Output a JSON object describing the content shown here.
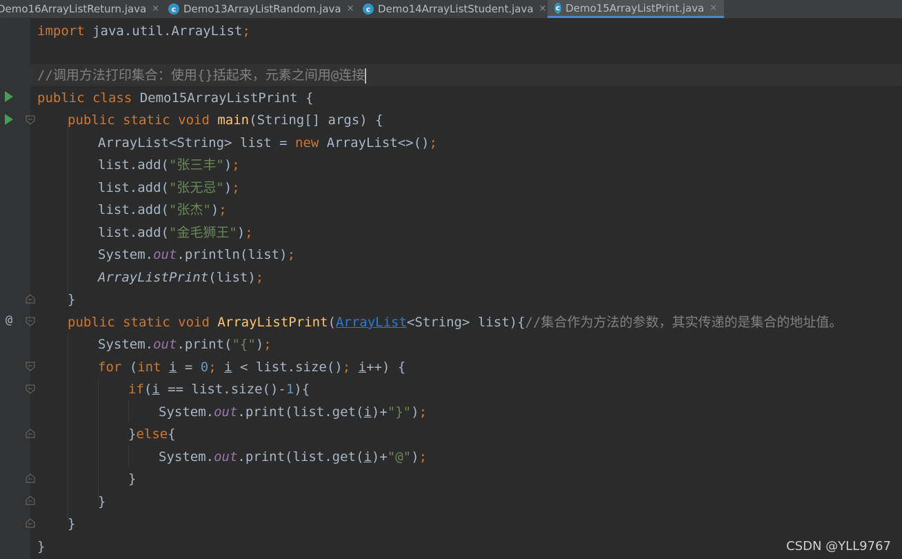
{
  "tabs": [
    {
      "label": "Demo16ArrayListReturn.java",
      "active": false
    },
    {
      "label": "Demo13ArrayListRandom.java",
      "active": false
    },
    {
      "label": "Demo14ArrayListStudent.java",
      "active": false
    },
    {
      "label": "Demo15ArrayListPrint.java",
      "active": true
    }
  ],
  "tab_close_glyph": "×",
  "file_icon_letter": "c",
  "gutter_at_glyph": "@",
  "code": {
    "import_kw": "import",
    "import_path": " java.util.ArrayList",
    "semicolon": ";",
    "comment_top": "//调用方法打印集合：使用{}括起来，元素之间用@连接",
    "class_decl": "public class",
    "class_name": " Demo15ArrayListPrint {",
    "main_mods": "public static void",
    "main_name": "main",
    "main_params": "(String[] args) {",
    "list_decl_type": "ArrayList<String> list = ",
    "new_kw": "new",
    "list_decl_rest": " ArrayList<>()",
    "add_prefix": "list.add(",
    "add_values": [
      "\"张三丰\"",
      "\"张无忌\"",
      "\"张杰\"",
      "\"金毛狮王\""
    ],
    "add_suffix": ")",
    "system": "System.",
    "out": "out",
    "println_call": ".println(list)",
    "call_name": "ArrayListPrint",
    "call_args": "(list)",
    "close_brace": "}",
    "method_mods": "public static void",
    "method_name": "ArrayListPrint",
    "method_open_paren": "(",
    "method_param_type": "ArrayList",
    "method_param_rest": "<String> list){",
    "method_comment": "//集合作为方法的参数，其实传递的是集合的地址值。",
    "print_call": ".print(",
    "open_brace_str": "\"{\"",
    "print_close": ")",
    "for_kw": "for",
    "for_paren": " (",
    "int_kw": "int",
    "var_i": "i",
    "eq_sign": " = ",
    "zero": "0",
    "lt_cond": " < list.size()",
    "incr": "++) {",
    "if_kw": "if",
    "if_open": "(",
    "if_cond_rest": " == list.size()-",
    "one": "1",
    "if_close": "){",
    "get_open": ".print(list.get(",
    "get_close": ")+",
    "close_brace_str": "\"}\"",
    "at_str": "\"@\"",
    "else_open": "}",
    "else_kw": "else",
    "else_brace": "{"
  },
  "watermark": "CSDN @YLL9767",
  "colors": {
    "background": "#2b2b2b",
    "keyword": "#cc7832",
    "string": "#6a8759",
    "number": "#6897bb",
    "comment": "#808080",
    "function": "#ffc66d",
    "static_field": "#9876aa",
    "active_tab_accent": "#4a88c7"
  }
}
